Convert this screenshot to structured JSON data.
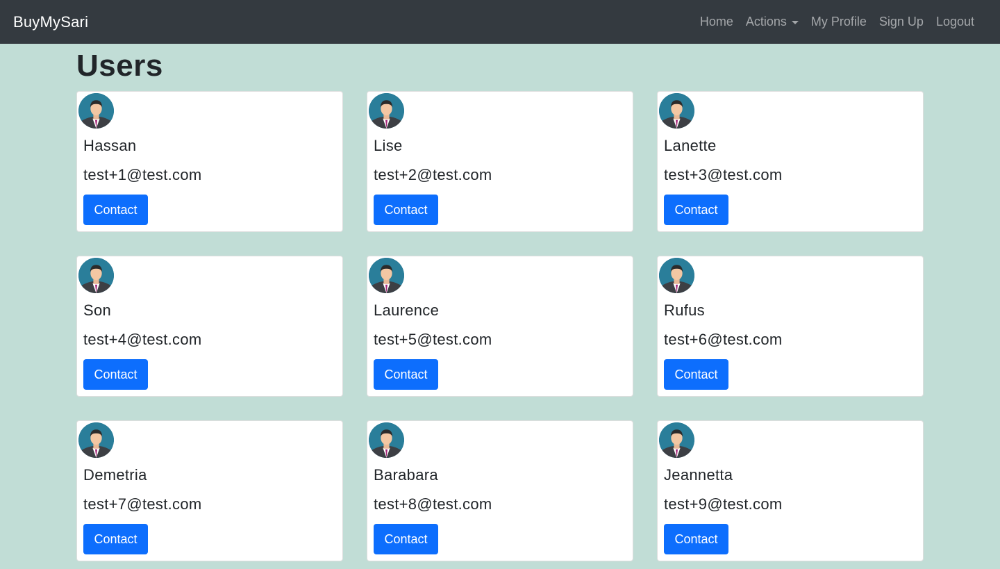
{
  "navbar": {
    "brand": "BuyMySari",
    "links": {
      "home": "Home",
      "actions": "Actions",
      "my_profile": "My Profile",
      "sign_up": "Sign Up",
      "logout": "Logout"
    }
  },
  "page": {
    "title": "Users"
  },
  "users": [
    {
      "name": "Hassan",
      "email": "test+1@test.com",
      "button": "Contact"
    },
    {
      "name": "Lise",
      "email": "test+2@test.com",
      "button": "Contact"
    },
    {
      "name": "Lanette",
      "email": "test+3@test.com",
      "button": "Contact"
    },
    {
      "name": "Son",
      "email": "test+4@test.com",
      "button": "Contact"
    },
    {
      "name": "Laurence",
      "email": "test+5@test.com",
      "button": "Contact"
    },
    {
      "name": "Rufus",
      "email": "test+6@test.com",
      "button": "Contact"
    },
    {
      "name": "Demetria",
      "email": "test+7@test.com",
      "button": "Contact"
    },
    {
      "name": "Barabara",
      "email": "test+8@test.com",
      "button": "Contact"
    },
    {
      "name": "Jeannetta",
      "email": "test+9@test.com",
      "button": "Contact"
    }
  ],
  "colors": {
    "navbar_bg": "#343a40",
    "page_bg": "#c1ddd6",
    "primary_button": "#0d6efd",
    "card_bg": "#ffffff"
  },
  "icons": {
    "avatar": "user-avatar-icon",
    "dropdown": "caret-down-icon"
  }
}
